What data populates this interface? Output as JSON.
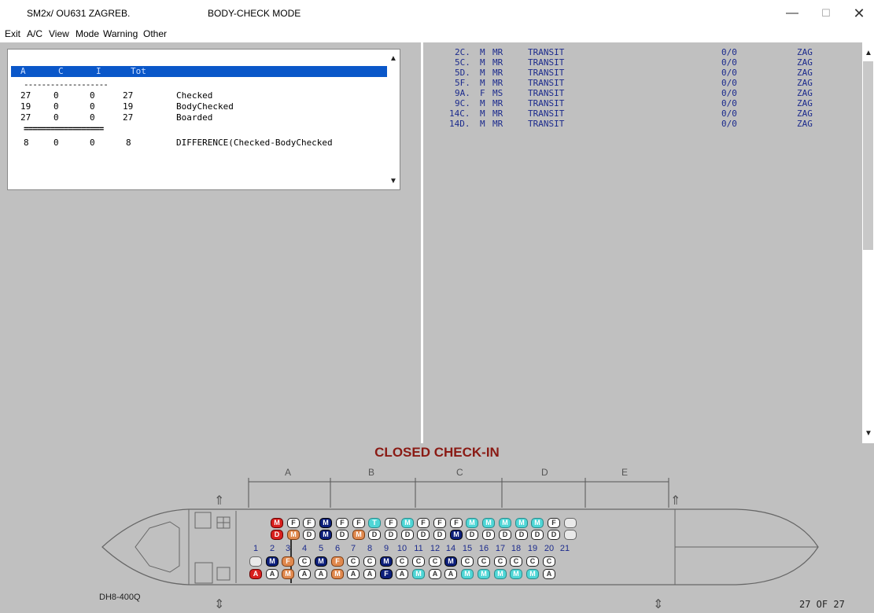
{
  "window": {
    "title": "SM2x/ OU631  ZAGREB.",
    "mode": "BODY-CHECK MODE",
    "minimize": "—",
    "maximize": "☐",
    "close": "✕"
  },
  "menu": [
    "Exit",
    "A/C",
    "View",
    "Mode",
    "Warning",
    "Other"
  ],
  "summary": {
    "headers": [
      "A",
      "C",
      "I",
      "Tot"
    ],
    "separator1": "-------------------",
    "separator2": "==================",
    "rows": [
      {
        "a": "27",
        "c": "0",
        "i": "0",
        "tot": "27",
        "label": "Checked"
      },
      {
        "a": "19",
        "c": "0",
        "i": "0",
        "tot": "19",
        "label": "BodyChecked"
      },
      {
        "a": "27",
        "c": "0",
        "i": "0",
        "tot": "27",
        "label": "Boarded"
      }
    ],
    "difference": {
      "a": "8",
      "c": "0",
      "i": "0",
      "tot": "8",
      "label": "DIFFERENCE(Checked-BodyChecked"
    }
  },
  "passengers": [
    {
      "seat": "2C.",
      "g": "M",
      "t": "MR",
      "status": "TRANSIT",
      "bags": "0/0",
      "dest": "ZAG"
    },
    {
      "seat": "5C.",
      "g": "M",
      "t": "MR",
      "status": "TRANSIT",
      "bags": "0/0",
      "dest": "ZAG"
    },
    {
      "seat": "5D.",
      "g": "M",
      "t": "MR",
      "status": "TRANSIT",
      "bags": "0/0",
      "dest": "ZAG"
    },
    {
      "seat": "5F.",
      "g": "M",
      "t": "MR",
      "status": "TRANSIT",
      "bags": "0/0",
      "dest": "ZAG"
    },
    {
      "seat": "9A.",
      "g": "F",
      "t": "MS",
      "status": "TRANSIT",
      "bags": "0/0",
      "dest": "ZAG"
    },
    {
      "seat": "9C.",
      "g": "M",
      "t": "MR",
      "status": "TRANSIT",
      "bags": "0/0",
      "dest": "ZAG"
    },
    {
      "seat": "14C.",
      "g": "M",
      "t": "MR",
      "status": "TRANSIT",
      "bags": "0/0",
      "dest": "ZAG"
    },
    {
      "seat": "14D.",
      "g": "M",
      "t": "MR",
      "status": "TRANSIT",
      "bags": "0/0",
      "dest": "ZAG"
    }
  ],
  "seatmap": {
    "title": "CLOSED CHECK-IN",
    "zones": [
      "A",
      "B",
      "C",
      "D",
      "E"
    ],
    "aircraft_type": "DH8-400Q",
    "count": "27 OF 27",
    "row_numbers": [
      "1",
      "2",
      "3",
      "4",
      "5",
      "6",
      "7",
      "8",
      "9",
      "10",
      "11",
      "12",
      "14",
      "15",
      "16",
      "17",
      "18",
      "19",
      "20",
      "21"
    ],
    "colors": {
      "red": "#d8201e",
      "navy": "#0d1f7a",
      "orange": "#e0894e",
      "cyan": "#4fd6d6"
    },
    "rows": {
      "F": [
        [
          "M",
          "red"
        ],
        [
          "F",
          "white"
        ],
        [
          "F",
          "white"
        ],
        [
          "M",
          "navy"
        ],
        [
          "F",
          "white"
        ],
        [
          "F",
          "white"
        ],
        [
          "T",
          "cyan"
        ],
        [
          "F",
          "white"
        ],
        [
          "M",
          "cyan"
        ],
        [
          "F",
          "white"
        ],
        [
          "F",
          "white"
        ],
        [
          "F",
          "white"
        ],
        [
          "M",
          "cyan"
        ],
        [
          "M",
          "cyan"
        ],
        [
          "M",
          "cyan"
        ],
        [
          "M",
          "cyan"
        ],
        [
          "M",
          "cyan"
        ],
        [
          "F",
          "white"
        ],
        [
          "",
          "empty"
        ]
      ],
      "D": [
        [
          "D",
          "red"
        ],
        [
          "M",
          "orange"
        ],
        [
          "D",
          "white"
        ],
        [
          "M",
          "navy"
        ],
        [
          "D",
          "white"
        ],
        [
          "M",
          "orange"
        ],
        [
          "D",
          "white"
        ],
        [
          "D",
          "white"
        ],
        [
          "D",
          "white"
        ],
        [
          "D",
          "white"
        ],
        [
          "D",
          "white"
        ],
        [
          "M",
          "navy"
        ],
        [
          "D",
          "white"
        ],
        [
          "D",
          "white"
        ],
        [
          "D",
          "white"
        ],
        [
          "D",
          "white"
        ],
        [
          "D",
          "white"
        ],
        [
          "D",
          "white"
        ],
        [
          "",
          "empty"
        ]
      ],
      "C": [
        [
          "",
          "empty"
        ],
        [
          "M",
          "navy"
        ],
        [
          "F",
          "orange"
        ],
        [
          "C",
          "white"
        ],
        [
          "M",
          "navy"
        ],
        [
          "F",
          "orange"
        ],
        [
          "C",
          "white"
        ],
        [
          "C",
          "white"
        ],
        [
          "M",
          "navy"
        ],
        [
          "C",
          "white"
        ],
        [
          "C",
          "white"
        ],
        [
          "C",
          "white"
        ],
        [
          "M",
          "navy"
        ],
        [
          "C",
          "white"
        ],
        [
          "C",
          "white"
        ],
        [
          "C",
          "white"
        ],
        [
          "C",
          "white"
        ],
        [
          "C",
          "white"
        ],
        [
          "C",
          "white"
        ]
      ],
      "A": [
        [
          "A",
          "red"
        ],
        [
          "A",
          "white"
        ],
        [
          "M",
          "orange"
        ],
        [
          "A",
          "white"
        ],
        [
          "A",
          "white"
        ],
        [
          "M",
          "orange"
        ],
        [
          "A",
          "white"
        ],
        [
          "A",
          "white"
        ],
        [
          "F",
          "navy"
        ],
        [
          "A",
          "white"
        ],
        [
          "M",
          "cyan"
        ],
        [
          "A",
          "white"
        ],
        [
          "A",
          "white"
        ],
        [
          "M",
          "cyan"
        ],
        [
          "M",
          "cyan"
        ],
        [
          "M",
          "cyan"
        ],
        [
          "M",
          "cyan"
        ],
        [
          "M",
          "cyan"
        ],
        [
          "A",
          "white"
        ]
      ]
    }
  }
}
